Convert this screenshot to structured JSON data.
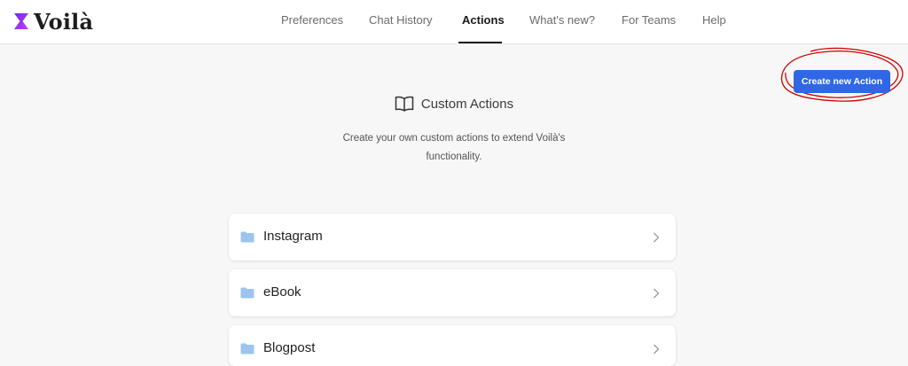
{
  "app": {
    "name": "Voilà"
  },
  "nav": {
    "items": [
      {
        "label": "Preferences"
      },
      {
        "label": "Chat History"
      },
      {
        "label": "Actions",
        "active": true
      },
      {
        "label": "What's new?"
      },
      {
        "label": "For Teams"
      },
      {
        "label": "Help"
      }
    ]
  },
  "toolbar": {
    "create_label": "Create new Action"
  },
  "main": {
    "title": "Custom Actions",
    "subtitle": "Create your own custom actions to extend Voilà's functionality."
  },
  "actions": [
    {
      "label": "Instagram",
      "icon": "folder-icon"
    },
    {
      "label": "eBook",
      "icon": "folder-icon"
    },
    {
      "label": "Blogpost",
      "icon": "folder-icon"
    }
  ],
  "colors": {
    "accent": "#2f67e7",
    "logo_gradient": [
      "#6a2cf0",
      "#c43cf0"
    ],
    "folder": "#9cc4ee",
    "annotation": "#d00000"
  }
}
